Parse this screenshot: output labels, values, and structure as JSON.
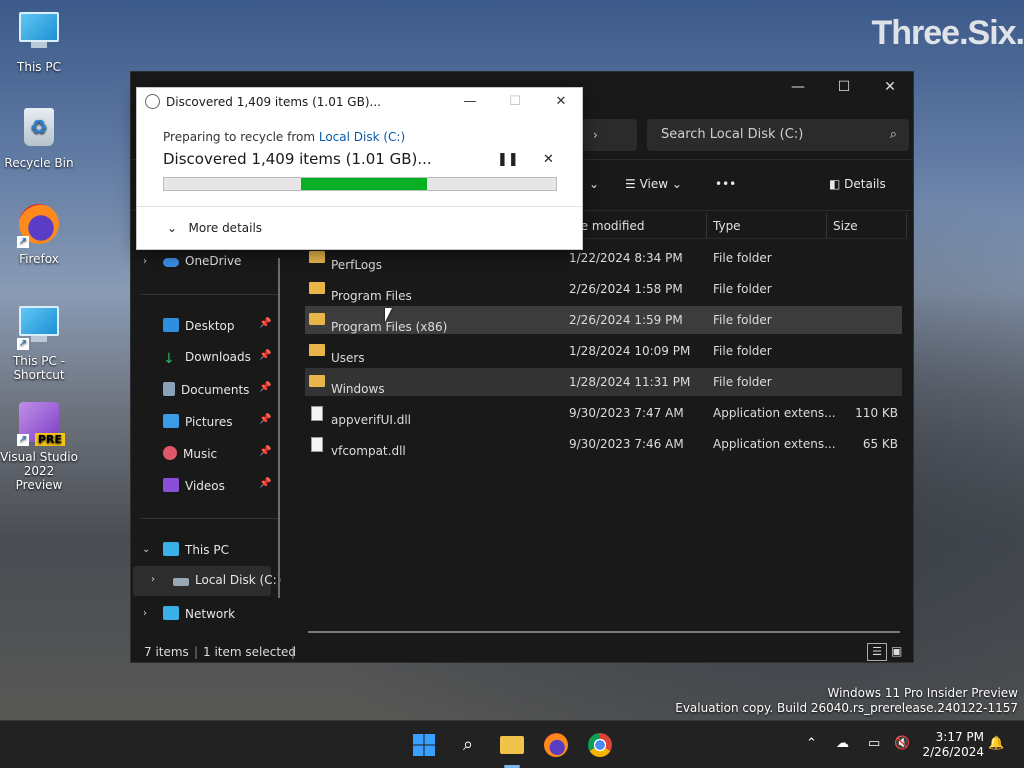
{
  "desktop": {
    "brand": "Three.Six.",
    "icons": [
      {
        "label": "This PC"
      },
      {
        "label": "Recycle Bin"
      },
      {
        "label": "Firefox"
      },
      {
        "label": "This PC - Shortcut"
      },
      {
        "label": "Visual Studio 2022 Preview"
      }
    ],
    "pre_badge": "PRE",
    "watermark_line1": "Windows 11 Pro Insider Preview",
    "watermark_line2": "Evaluation copy. Build 26040.rs_prerelease.240122-1157"
  },
  "dialog": {
    "title": "Discovered 1,409 items (1.01 GB)...",
    "subtitle_prefix": "Preparing to recycle from ",
    "subtitle_link": "Local Disk (C:)",
    "main_text": "Discovered 1,409 items (1.01 GB)...",
    "progress_start": 0.35,
    "progress_end": 0.67,
    "more_details": "More details"
  },
  "explorer": {
    "search_placeholder": "Search Local Disk (C:)",
    "toolbar": {
      "view_label": "View",
      "details_label": "Details"
    },
    "columns": [
      "te modified",
      "Type",
      "Size"
    ],
    "sidebar": {
      "onedrive": "OneDrive",
      "quick": [
        {
          "label": "Desktop",
          "color": "#2d8fe0"
        },
        {
          "label": "Downloads",
          "color": "#2fb36b"
        },
        {
          "label": "Documents",
          "color": "#8aa2b8"
        },
        {
          "label": "Pictures",
          "color": "#3a9be6"
        },
        {
          "label": "Music",
          "color": "#e0566a"
        },
        {
          "label": "Videos",
          "color": "#8a4fd8"
        }
      ],
      "this_pc": "This PC",
      "local_disk": "Local Disk (C:)",
      "network": "Network"
    },
    "files": [
      {
        "name": "PerfLogs",
        "date": "1/22/2024 8:34 PM",
        "type": "File folder",
        "size": "",
        "kind": "folder"
      },
      {
        "name": "Program Files",
        "date": "2/26/2024 1:58 PM",
        "type": "File folder",
        "size": "",
        "kind": "folder"
      },
      {
        "name": "Program Files (x86)",
        "date": "2/26/2024 1:59 PM",
        "type": "File folder",
        "size": "",
        "kind": "folder"
      },
      {
        "name": "Users",
        "date": "1/28/2024 10:09 PM",
        "type": "File folder",
        "size": "",
        "kind": "folder"
      },
      {
        "name": "Windows",
        "date": "1/28/2024 11:31 PM",
        "type": "File folder",
        "size": "",
        "kind": "folder"
      },
      {
        "name": "appverifUI.dll",
        "date": "9/30/2023 7:47 AM",
        "type": "Application extens...",
        "size": "110 KB",
        "kind": "dll"
      },
      {
        "name": "vfcompat.dll",
        "date": "9/30/2023 7:46 AM",
        "type": "Application extens...",
        "size": "65 KB",
        "kind": "dll"
      }
    ],
    "status": {
      "count": "7 items",
      "selected": "1 item selected"
    }
  },
  "taskbar": {
    "time": "3:17 PM",
    "date": "2/26/2024"
  }
}
